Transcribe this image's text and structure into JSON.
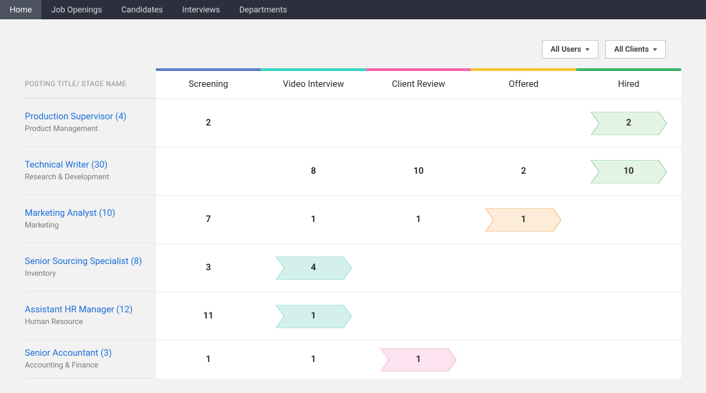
{
  "nav": {
    "items": [
      "Home",
      "Job Openings",
      "Candidates",
      "Interviews",
      "Departments"
    ],
    "activeIndex": 0
  },
  "filters": {
    "users": "All Users",
    "clients": "All Clients"
  },
  "table": {
    "leftHeader": "POSTING TITLE/ STAGE NAME",
    "stages": [
      "Screening",
      "Video Interview",
      "Client Review",
      "Offered",
      "Hired"
    ],
    "stageColors": [
      "#607fc9",
      "#3cd5c0",
      "#f767b0",
      "#f1c52f",
      "#3cb46b"
    ]
  },
  "jobs": [
    {
      "title": "Production Supervisor (4)",
      "department": "Product Management",
      "cells": [
        {
          "value": "2"
        },
        {
          "value": ""
        },
        {
          "value": ""
        },
        {
          "value": ""
        },
        {
          "value": "2",
          "chip": {
            "fill": "#e3f4e5",
            "stroke": "#8fd19a"
          }
        }
      ]
    },
    {
      "title": "Technical Writer (30)",
      "department": "Research & Development",
      "highlight": true,
      "cells": [
        {
          "value": ""
        },
        {
          "value": "8"
        },
        {
          "value": "10"
        },
        {
          "value": "2"
        },
        {
          "value": "10",
          "chip": {
            "fill": "#e3f4e5",
            "stroke": "#8fd19a"
          }
        }
      ]
    },
    {
      "title": "Marketing Analyst (10)",
      "department": "Marketing",
      "cells": [
        {
          "value": "7"
        },
        {
          "value": "1"
        },
        {
          "value": "1"
        },
        {
          "value": "1",
          "chip": {
            "fill": "#fdecd8",
            "stroke": "#f2b774"
          }
        },
        {
          "value": ""
        }
      ]
    },
    {
      "title": "Senior Sourcing Specialist (8)",
      "department": "Inventory",
      "cells": [
        {
          "value": "3"
        },
        {
          "value": "4",
          "chip": {
            "fill": "#d3f0ed",
            "stroke": "#9fdcd5"
          }
        },
        {
          "value": ""
        },
        {
          "value": ""
        },
        {
          "value": ""
        }
      ]
    },
    {
      "title": "Assistant HR Manager (12)",
      "department": "Human Resource",
      "cells": [
        {
          "value": "11"
        },
        {
          "value": "1",
          "chip": {
            "fill": "#d3f0ed",
            "stroke": "#9fdcd5"
          }
        },
        {
          "value": ""
        },
        {
          "value": ""
        },
        {
          "value": ""
        }
      ]
    },
    {
      "title": "Senior Accountant (3)",
      "department": "Accounting & Finance",
      "cells": [
        {
          "value": "1"
        },
        {
          "value": "1"
        },
        {
          "value": "1",
          "chip": {
            "fill": "#fde3f0",
            "stroke": "#f3b6d6"
          }
        },
        {
          "value": ""
        },
        {
          "value": ""
        }
      ]
    }
  ]
}
